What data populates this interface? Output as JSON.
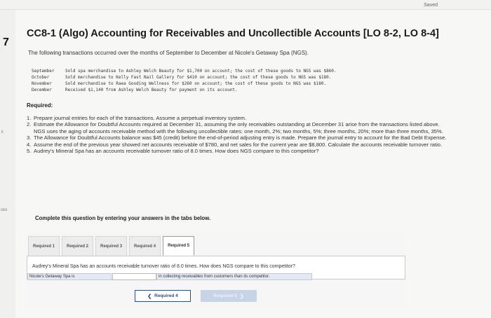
{
  "header": {
    "saved_label": "Saved",
    "question_number": "7"
  },
  "gutter": {
    "mark": "k",
    "ces": "ces"
  },
  "title": "CC8-1 (Algo) Accounting for Receivables and Uncollectible Accounts [LO 8-2, LO 8-4]",
  "intro": "The following transactions occurred over the months of September to December at Nicole's Getaway Spa (NGS).",
  "transactions": [
    {
      "month": "September",
      "text": "Sold spa merchandise to Ashley Welch Beauty for $1,700 on account; the cost of these goods to NGS was $860."
    },
    {
      "month": "October",
      "text": "Sold merchandise to Kelly Fast Nail Gallery for $410 on account; the cost of these goods to NGS was $180."
    },
    {
      "month": "November",
      "text": "Sold merchandise to Raea Gooding Wellness for $260 on account; the cost of these goods to NGS was $180."
    },
    {
      "month": "December",
      "text": "Received $1,140 from Ashley Welch Beauty for payment on its account."
    }
  ],
  "required_heading": "Required:",
  "requirements": [
    {
      "num": "1.",
      "text": "Prepare journal entries for each of the transactions. Assume a perpetual inventory system."
    },
    {
      "num": "2.",
      "text": "Estimate the Allowance for Doubtful Accounts required at December 31, assuming the only receivables outstanding at December 31 arise from the transactions listed above. NGS uses the aging of accounts receivable method with the following uncollectible rates: one month, 2%; two months, 5%; three months, 20%; more than three months, 35%."
    },
    {
      "num": "3.",
      "text": "The Allowance for Doubtful Accounts balance was $45 (credit) before the end-of-period adjusting entry is made. Prepare the journal entry to account for the Bad Debt Expense."
    },
    {
      "num": "4.",
      "text": "Assume the end of the previous year showed net accounts receivable of $780, and net sales for the current year are $8,800. Calculate the accounts receivable turnover ratio."
    },
    {
      "num": "5.",
      "text": "Audrey's Mineral Spa has an accounts receivable turnover ratio of 8.0 times. How does NGS compare to this competitor?"
    }
  ],
  "complete_note": "Complete this question by entering your answers in the tabs below.",
  "tabs": [
    {
      "label": "Required 1",
      "active": false
    },
    {
      "label": "Required 2",
      "active": false
    },
    {
      "label": "Required 3",
      "active": false
    },
    {
      "label": "Required 4",
      "active": false
    },
    {
      "label": "Required 5",
      "active": true
    }
  ],
  "question": "Audrey's Mineral Spa has an accounts receivable turnover ratio of 8.0 times. How does NGS compare to this competitor?",
  "answer": {
    "label": "Nicole's Getaway Spa is",
    "input_value": "",
    "tail": "in collecting receivables from customers than its competitor."
  },
  "nav": {
    "prev_label": "Required 4",
    "next_label": "Required 5"
  },
  "colors": {
    "accent": "#2b4e8c",
    "answer_bg": "#e4e9f3"
  }
}
